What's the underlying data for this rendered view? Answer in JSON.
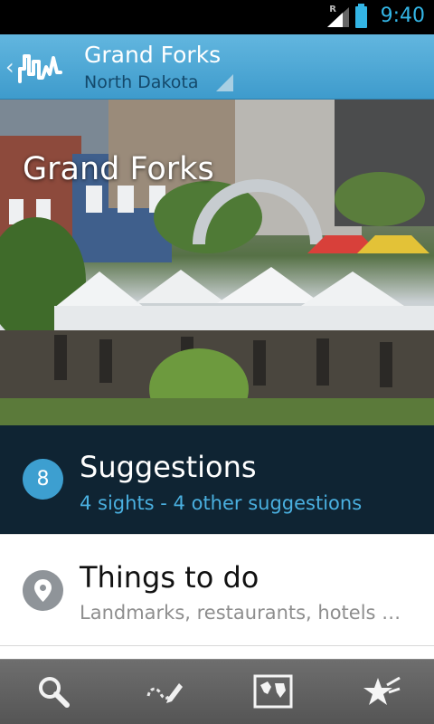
{
  "status_bar": {
    "time": "9:40",
    "roaming_indicator": "R"
  },
  "action_bar": {
    "title": "Grand Forks",
    "subtitle": "North Dakota",
    "accent": "#4aa7d6"
  },
  "hero": {
    "title": "Grand Forks"
  },
  "list": [
    {
      "badge": "8",
      "title": "Suggestions",
      "subtitle": "4 sights - 4 other suggestions",
      "icon": "count-badge"
    },
    {
      "title": "Things to do",
      "subtitle": "Landmarks, restaurants, hotels …",
      "icon": "map-pin-icon"
    }
  ],
  "bottom_bar": {
    "buttons": [
      {
        "icon": "search-icon"
      },
      {
        "icon": "edit-route-icon"
      },
      {
        "icon": "world-map-icon"
      },
      {
        "icon": "starred-icon"
      }
    ]
  }
}
